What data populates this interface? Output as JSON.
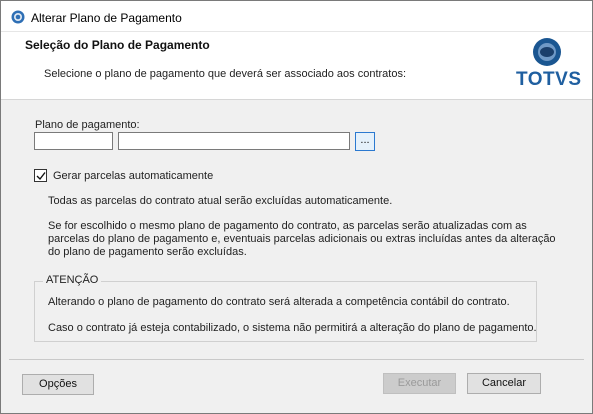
{
  "window": {
    "title": "Alterar Plano de Pagamento"
  },
  "header": {
    "title": "Seleção do Plano de Pagamento",
    "subtitle": "Selecione o plano de pagamento que deverá ser associado aos contratos:",
    "logo_text": "TOTVS"
  },
  "form": {
    "plan_label": "Plano de pagamento:",
    "plan_code_value": "",
    "plan_description_value": "",
    "lookup_button_label": "...",
    "auto_generate_label": "Gerar parcelas automaticamente",
    "auto_generate_checked": true,
    "info_line1": "Todas as parcelas do contrato atual serão excluídas automaticamente.",
    "info_line2": "Se for escolhido o mesmo plano de pagamento do contrato, as parcelas serão atualizadas com as parcelas do plano de pagamento e, eventuais parcelas adicionais ou extras incluídas antes da alteração do plano de pagamento serão excluídas."
  },
  "attention": {
    "title": "ATENÇÃO",
    "line1": "Alterando o plano de pagamento do contrato será alterada a competência contábil do contrato.",
    "line2": "Caso o contrato já esteja contabilizado, o sistema não permitirá a alteração do plano de pagamento."
  },
  "footer": {
    "options_label": "Opções",
    "execute_label": "Executar",
    "execute_enabled": false,
    "cancel_label": "Cancelar"
  },
  "colors": {
    "brand_blue": "#1f5fa0",
    "window_bg": "#f0f0f0",
    "lookup_border": "#2b79d0"
  }
}
